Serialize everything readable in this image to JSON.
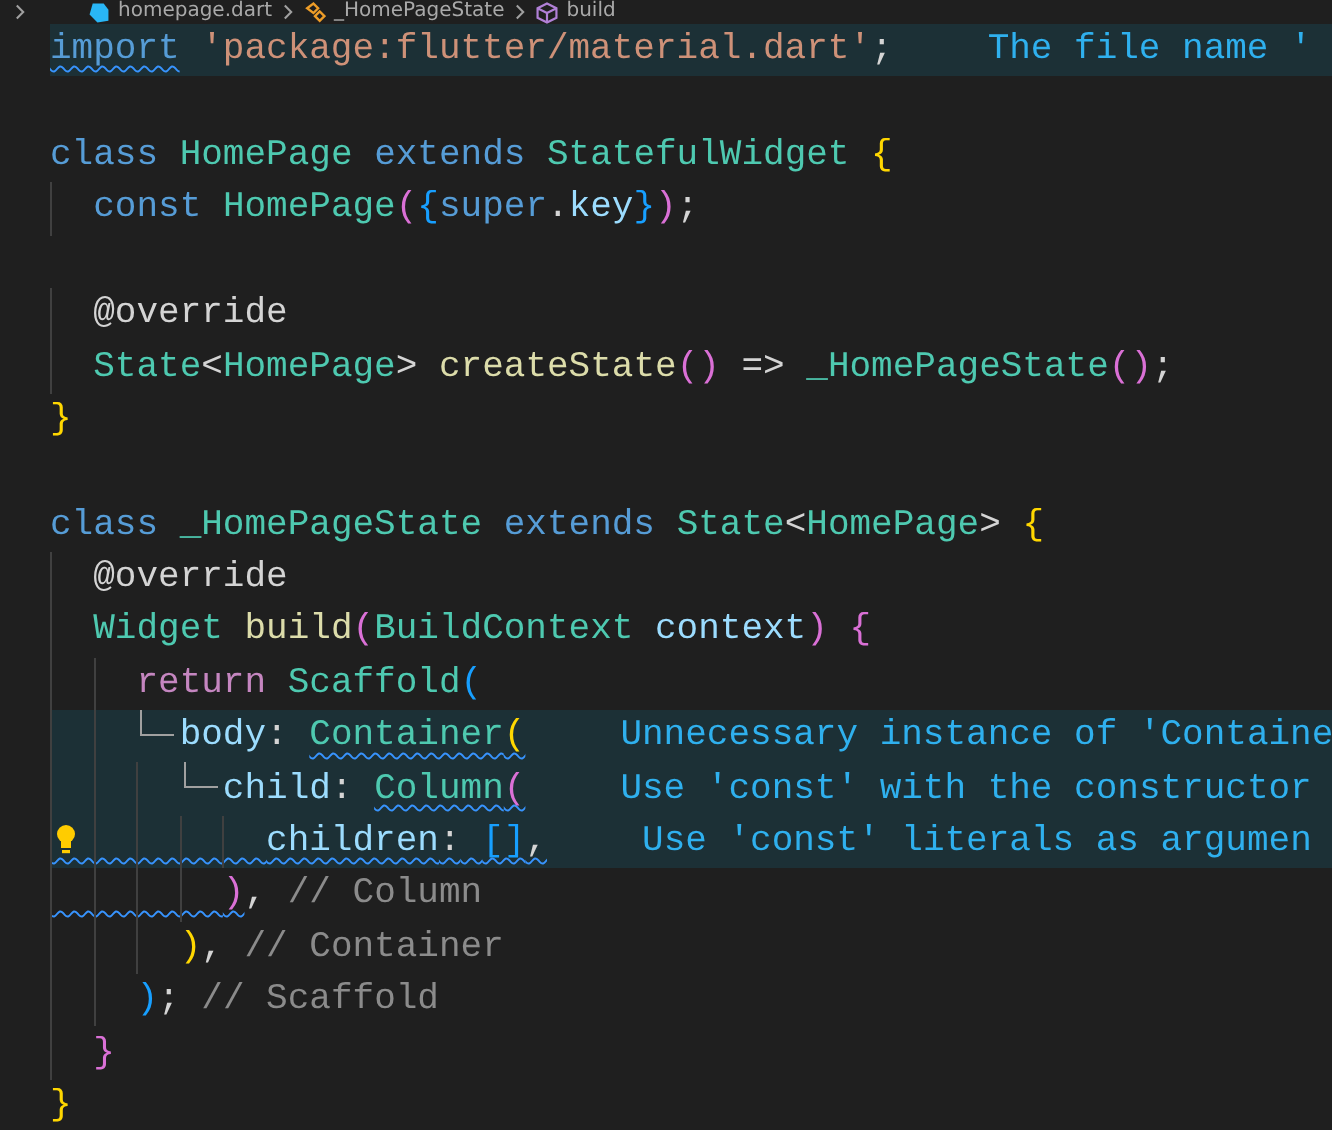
{
  "breadcrumbs": [
    {
      "label": "homepage.dart",
      "kind": "file"
    },
    {
      "label": "_HomePageState",
      "kind": "class"
    },
    {
      "label": "build",
      "kind": "method"
    }
  ],
  "lines": [
    {
      "highlighted": true,
      "hint": "The file name '",
      "tokens": [
        {
          "text": "import",
          "kind": "keyword",
          "squiggle": true,
          "space_after": true
        },
        {
          "text": "'package:flutter/material.dart'",
          "kind": "string"
        },
        {
          "text": ";",
          "kind": "plain"
        }
      ]
    },
    {
      "blank_before": true,
      "tokens": [
        {
          "text": "class",
          "kind": "keyword",
          "space_after": true
        },
        {
          "text": "HomePage",
          "kind": "type",
          "space_after": true
        },
        {
          "text": "extends",
          "kind": "keyword",
          "space_after": true
        },
        {
          "text": "StatefulWidget",
          "kind": "type",
          "space_after": true
        },
        {
          "text": "{",
          "kind": "bracket1"
        }
      ],
      "children": [
        {
          "tokens": [
            {
              "text": "const",
              "kind": "keyword",
              "space_after": true
            },
            {
              "text": "HomePage",
              "kind": "type"
            },
            {
              "text": "(",
              "kind": "bracket2"
            },
            {
              "text": "{",
              "kind": "bracket3"
            },
            {
              "text": "super",
              "kind": "keyword"
            },
            {
              "text": ".",
              "kind": "plain"
            },
            {
              "text": "key",
              "kind": "variable"
            },
            {
              "text": "}",
              "kind": "bracket3"
            },
            {
              "text": ")",
              "kind": "bracket2"
            },
            {
              "text": ";",
              "kind": "plain"
            }
          ]
        },
        {
          "blank_before": true,
          "tokens": [
            {
              "text": "@override",
              "kind": "plain"
            }
          ]
        },
        {
          "tokens": [
            {
              "text": "State",
              "kind": "type"
            },
            {
              "text": "<",
              "kind": "plain"
            },
            {
              "text": "HomePage",
              "kind": "type"
            },
            {
              "text": ">",
              "kind": "plain",
              "space_after": true
            },
            {
              "text": "createState",
              "kind": "function"
            },
            {
              "text": "()",
              "kind": "bracket2",
              "space_after": true
            },
            {
              "text": "=>",
              "kind": "plain",
              "space_after": true
            },
            {
              "text": "_HomePageState",
              "kind": "type"
            },
            {
              "text": "()",
              "kind": "bracket2"
            },
            {
              "text": ";",
              "kind": "plain"
            }
          ]
        }
      ]
    },
    {
      "tokens": [
        {
          "text": "}",
          "kind": "bracket1"
        }
      ]
    },
    {
      "blank_before": true,
      "tokens": [
        {
          "text": "class",
          "kind": "keyword",
          "space_after": true
        },
        {
          "text": "_HomePageState",
          "kind": "type",
          "space_after": true
        },
        {
          "text": "extends",
          "kind": "keyword",
          "space_after": true
        },
        {
          "text": "State",
          "kind": "type"
        },
        {
          "text": "<",
          "kind": "plain"
        },
        {
          "text": "HomePage",
          "kind": "type"
        },
        {
          "text": ">",
          "kind": "plain",
          "space_after": true
        },
        {
          "text": "{",
          "kind": "bracket1"
        }
      ],
      "children": [
        {
          "tokens": [
            {
              "text": "@override",
              "kind": "plain"
            }
          ]
        },
        {
          "tokens": [
            {
              "text": "Widget",
              "kind": "type",
              "space_after": true
            },
            {
              "text": "build",
              "kind": "function"
            },
            {
              "text": "(",
              "kind": "bracket2"
            },
            {
              "text": "BuildContext",
              "kind": "type",
              "space_after": true
            },
            {
              "text": "context",
              "kind": "variable"
            },
            {
              "text": ")",
              "kind": "bracket2",
              "space_after": true
            },
            {
              "text": "{",
              "kind": "bracket2"
            }
          ],
          "children": [
            {
              "tokens": [
                {
                  "text": "return",
                  "kind": "control",
                  "space_after": true
                },
                {
                  "text": "Scaffold",
                  "kind": "type"
                },
                {
                  "text": "(",
                  "kind": "bracket3"
                }
              ],
              "children": [
                {
                  "highlighted": true,
                  "connector": true,
                  "hint": "Unnecessary instance of 'Containe",
                  "tokens": [
                    {
                      "text": "body",
                      "kind": "variable"
                    },
                    {
                      "text": ":",
                      "kind": "plain",
                      "space_after": true
                    },
                    {
                      "text": "Container",
                      "kind": "type",
                      "squiggle": true
                    },
                    {
                      "text": "(",
                      "kind": "bracket1",
                      "squiggle": true
                    }
                  ],
                  "children": [
                    {
                      "highlighted": true,
                      "connector": true,
                      "hint": "Use 'const' with the constructor",
                      "tokens": [
                        {
                          "text": "child",
                          "kind": "variable"
                        },
                        {
                          "text": ":",
                          "kind": "plain",
                          "space_after": true
                        },
                        {
                          "text": "Column",
                          "kind": "type",
                          "squiggle": true
                        },
                        {
                          "text": "(",
                          "kind": "bracket2",
                          "squiggle": true
                        }
                      ],
                      "children": [
                        {
                          "highlighted": true,
                          "lightbulb": true,
                          "indent_squiggle": true,
                          "hint": "Use 'const' literals as argumen",
                          "tokens": [
                            {
                              "text": "children",
                              "kind": "variable",
                              "squiggle": true
                            },
                            {
                              "text": ":",
                              "kind": "plain",
                              "squiggle": true,
                              "space_after": true
                            },
                            {
                              "text": "[]",
                              "kind": "bracket3",
                              "squiggle": true
                            },
                            {
                              "text": ",",
                              "kind": "plain",
                              "squiggle": true
                            }
                          ]
                        }
                      ]
                    },
                    {
                      "indent_squiggle": true,
                      "tokens": [
                        {
                          "text": ")",
                          "kind": "bracket2",
                          "squiggle": true
                        },
                        {
                          "text": ",",
                          "kind": "plain",
                          "space_after": true
                        },
                        {
                          "text": "// Column",
                          "kind": "comment"
                        }
                      ]
                    }
                  ]
                },
                {
                  "tokens": [
                    {
                      "text": ")",
                      "kind": "bracket1"
                    },
                    {
                      "text": ",",
                      "kind": "plain",
                      "space_after": true
                    },
                    {
                      "text": "// Container",
                      "kind": "comment"
                    }
                  ]
                }
              ]
            },
            {
              "tokens": [
                {
                  "text": ")",
                  "kind": "bracket3"
                },
                {
                  "text": ";",
                  "kind": "plain",
                  "space_after": true
                },
                {
                  "text": "// Scaffold",
                  "kind": "comment"
                }
              ]
            }
          ]
        },
        {
          "tokens": [
            {
              "text": "}",
              "kind": "bracket2"
            }
          ]
        }
      ]
    },
    {
      "tokens": [
        {
          "text": "}",
          "kind": "bracket1"
        }
      ]
    }
  ]
}
